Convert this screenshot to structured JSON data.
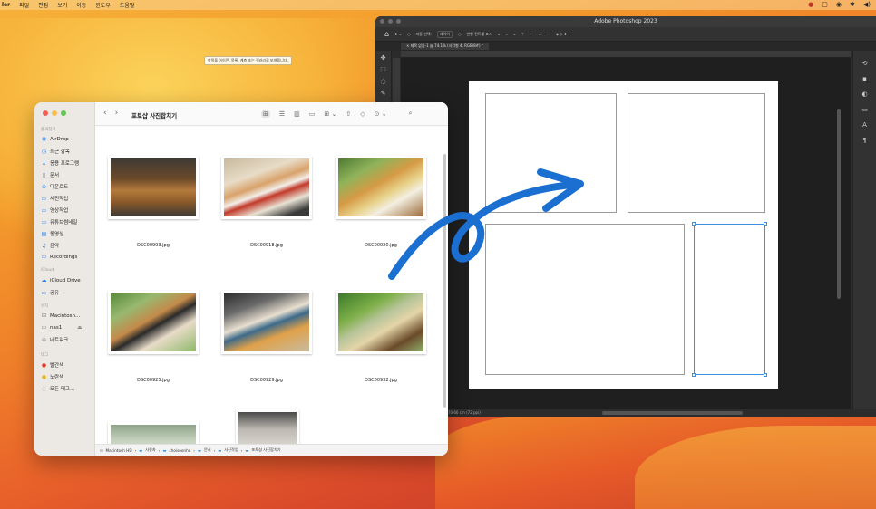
{
  "menubar": {
    "app": "ler",
    "items": [
      "파일",
      "편집",
      "보기",
      "이동",
      "윈도우",
      "도움말"
    ]
  },
  "tooltip": "항목을 아이콘, 목록, 계층 또는 갤러리로 보여줍니다.",
  "photoshop": {
    "title": "Adobe Photoshop 2023",
    "options": {
      "auto_select": "자동 선택:",
      "layer": "레이어",
      "transform_controls": "변형 컨트롤 표시"
    },
    "tab": "제목 없음-1 @ 74.1% (사각형 4, RGB/8#) *",
    "status": "70.66 cm (72 ppi)"
  },
  "finder": {
    "title": "포토샵 사진합치기",
    "sidebar": {
      "favorites_header": "즐겨찾기",
      "favorites": [
        {
          "icon": "airdrop-icon",
          "label": "AirDrop"
        },
        {
          "icon": "clock-icon",
          "label": "최근 항목"
        },
        {
          "icon": "applications-icon",
          "label": "응용 프로그램"
        },
        {
          "icon": "document-icon",
          "label": "문서"
        },
        {
          "icon": "download-icon",
          "label": "다운로드"
        },
        {
          "icon": "folder-icon",
          "label": "사진작업"
        },
        {
          "icon": "folder-icon",
          "label": "영상작업"
        },
        {
          "icon": "folder-icon",
          "label": "유튜브썸네일"
        },
        {
          "icon": "movie-icon",
          "label": "동영상"
        },
        {
          "icon": "music-icon",
          "label": "음악"
        },
        {
          "icon": "folder-icon",
          "label": "Recordings"
        }
      ],
      "icloud_header": "iCloud",
      "icloud": [
        {
          "icon": "cloud-icon",
          "label": "iCloud Drive"
        },
        {
          "icon": "shared-folder-icon",
          "label": "공유"
        }
      ],
      "locations_header": "위치",
      "locations": [
        {
          "icon": "disk-icon",
          "label": "Macintosh..."
        },
        {
          "icon": "display-icon",
          "label": "nas1"
        },
        {
          "icon": "globe-icon",
          "label": "네트워크"
        }
      ],
      "tags_header": "태그",
      "tags": [
        {
          "icon": "red-dot-icon",
          "label": "빨간색"
        },
        {
          "icon": "yellow-dot-icon",
          "label": "노란색"
        },
        {
          "icon": "tags-icon",
          "label": "모든 태그..."
        }
      ]
    },
    "files": [
      {
        "name": "DSC00903.jpg"
      },
      {
        "name": "DSC00918.jpg"
      },
      {
        "name": "DSC00920.jpg"
      },
      {
        "name": "DSC00925.jpg"
      },
      {
        "name": "DSC00929.jpg"
      },
      {
        "name": "DSC00932.jpg"
      }
    ],
    "path": [
      "Macintosh HD",
      "사용자",
      "choisoonho",
      "문서",
      "사진작업",
      "포토샵 사진합치기"
    ]
  },
  "colors": {
    "finder_sidebar_icon": "#2f7ee6",
    "arrow": "#1a6fd0",
    "selection": "#3b8fe0"
  }
}
